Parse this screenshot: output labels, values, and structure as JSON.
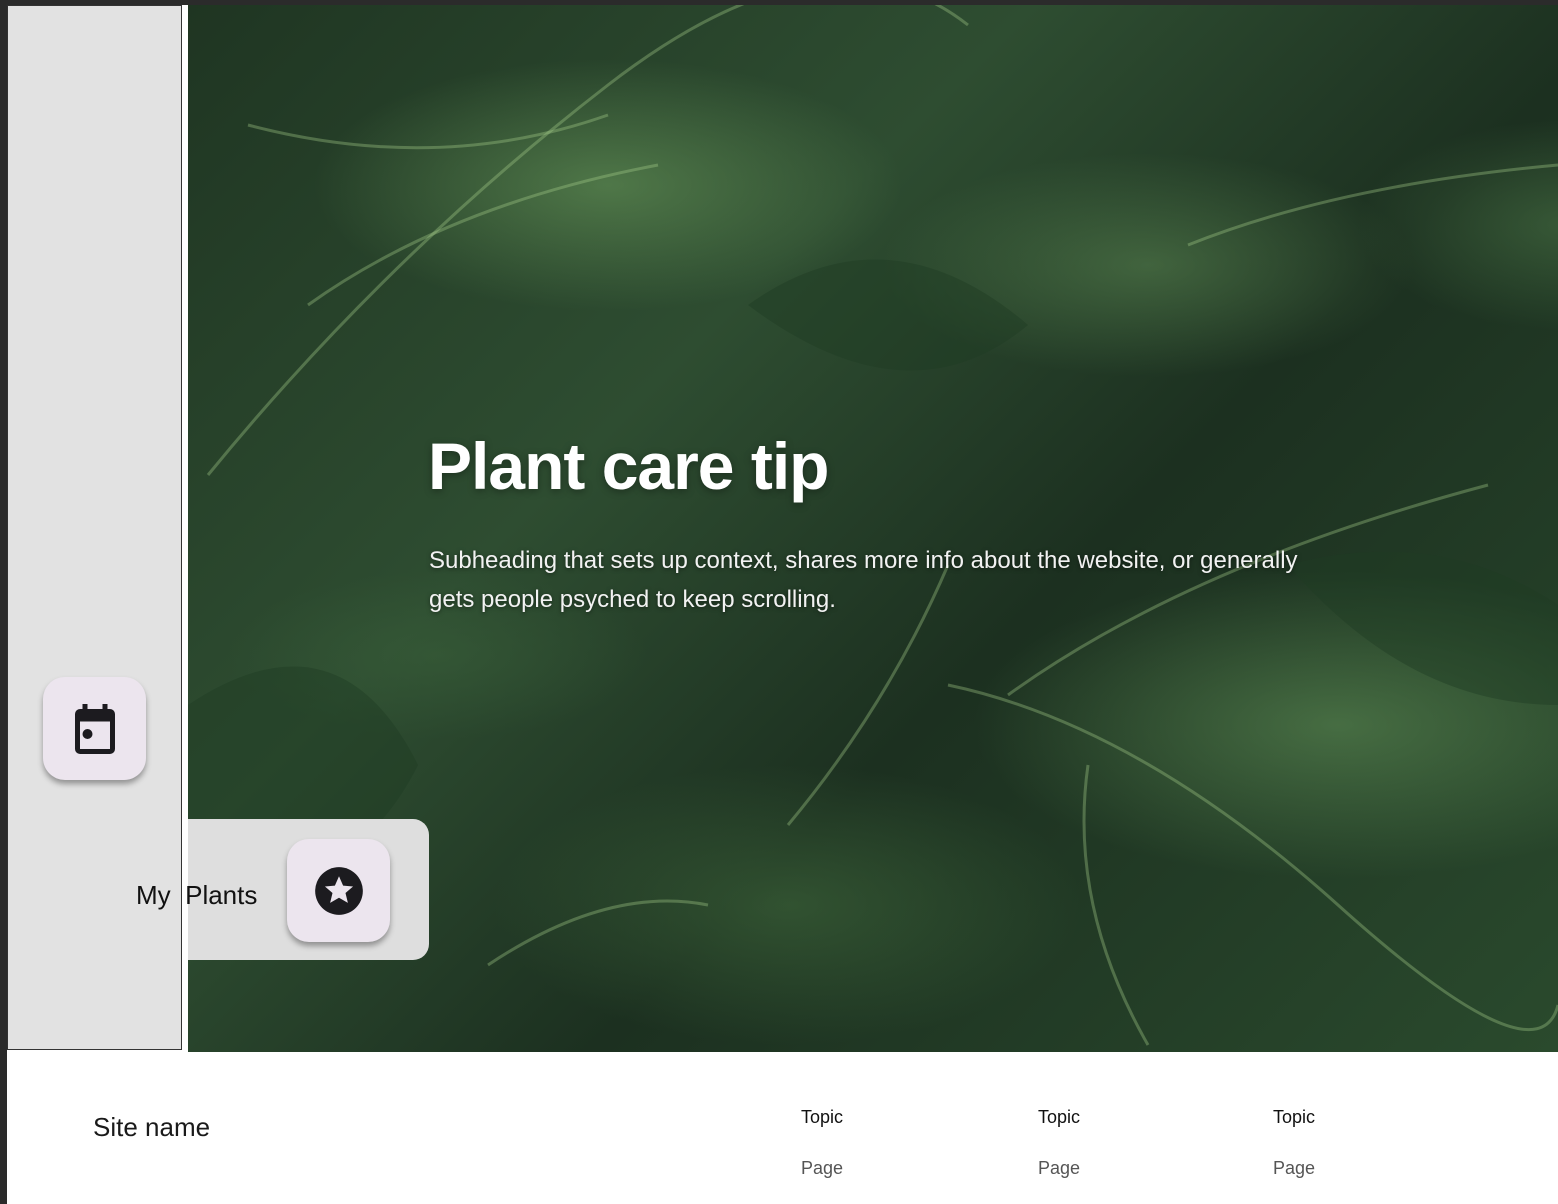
{
  "hero": {
    "title": "Plant care tip",
    "subtitle": "Subheading that sets up context, shares more info about the website, or generally gets people psyched to keep scrolling."
  },
  "nav": {
    "calendar_icon": "calendar-icon",
    "star_icon": "star-icon",
    "my_plants_label": "My  Plants"
  },
  "footer": {
    "site_name": "Site name",
    "columns": [
      {
        "title": "Topic",
        "page": "Page"
      },
      {
        "title": "Topic",
        "page": "Page"
      },
      {
        "title": "Topic",
        "page": "Page"
      }
    ]
  },
  "colors": {
    "sidebar": "#e2e2e2",
    "fab": "#ece5ee",
    "icon": "#1c1b1f"
  }
}
